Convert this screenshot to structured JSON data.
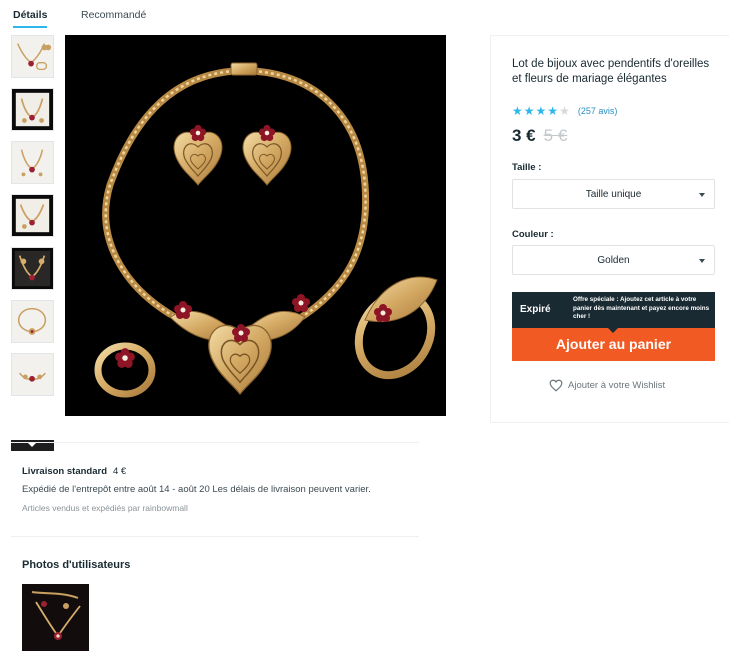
{
  "tabs": {
    "details": "Détails",
    "recommended": "Recommandé"
  },
  "product": {
    "title": "Lot de bijoux avec pendentifs d'oreilles et fleurs de mariage élégantes",
    "rating": 4,
    "rating_max": 5,
    "reviews": "(257 avis)",
    "price": "3 €",
    "original_price": "5 €"
  },
  "options": {
    "size_label": "Taille :",
    "size_value": "Taille unique",
    "color_label": "Couleur :",
    "color_value": "Golden"
  },
  "offer": {
    "status": "Expiré",
    "text": "Offre spéciale : Ajoutez cet article à votre panier dès maintenant et payez encore moins cher !"
  },
  "actions": {
    "add_to_cart": "Ajouter au panier",
    "wishlist": "Ajouter à votre Wishlist"
  },
  "shipping": {
    "title": "Livraison standard",
    "cost": "4 €",
    "description": "Expédié de l'entrepôt entre août 14 - août 20 Les délais de livraison peuvent varier.",
    "seller": "Articles vendus et expédiés par rainbowmall"
  },
  "user_photos": {
    "title": "Photos d'utilisateurs"
  },
  "gallery": {
    "thumbnail_count": 7,
    "icons": {
      "star": "star-icon",
      "heart": "heart-icon",
      "caret": "chevron-down-icon"
    }
  },
  "colors": {
    "accent_blue": "#2fb7ec",
    "cart_orange": "#f15a22",
    "dark": "#192a32",
    "gold": "#d9b16a",
    "ruby": "#8e1526"
  }
}
